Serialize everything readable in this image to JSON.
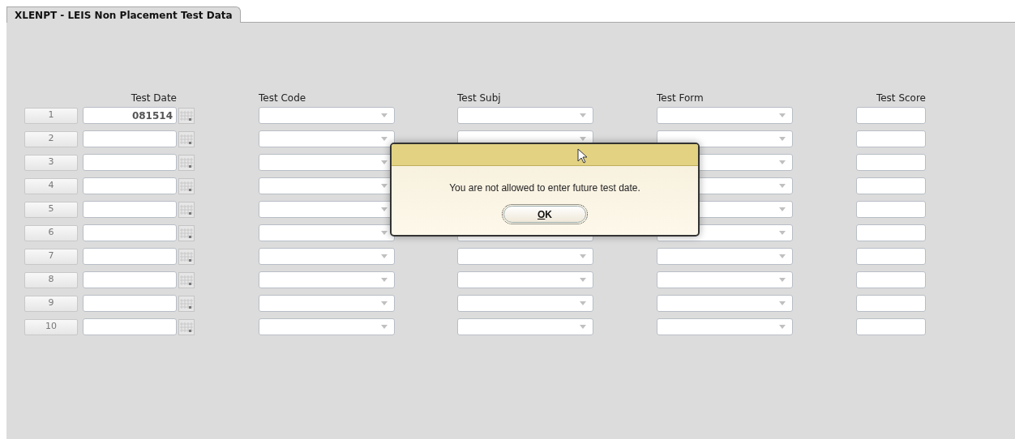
{
  "tab": {
    "label": "XLENPT - LEIS Non Placement Test Data",
    "selected": true
  },
  "columns": [
    "Test Date",
    "Test Code",
    "Test Subj",
    "Test Form",
    "Test Score"
  ],
  "rows": [
    {
      "number": "1",
      "test_date": "081514"
    },
    {
      "number": "2"
    },
    {
      "number": "3"
    },
    {
      "number": "4"
    },
    {
      "number": "5"
    },
    {
      "number": "6"
    },
    {
      "number": "7"
    },
    {
      "number": "8"
    },
    {
      "number": "9"
    },
    {
      "number": "10"
    }
  ],
  "dialog": {
    "message": "You are not allowed to enter future test date.",
    "button": "OK"
  }
}
